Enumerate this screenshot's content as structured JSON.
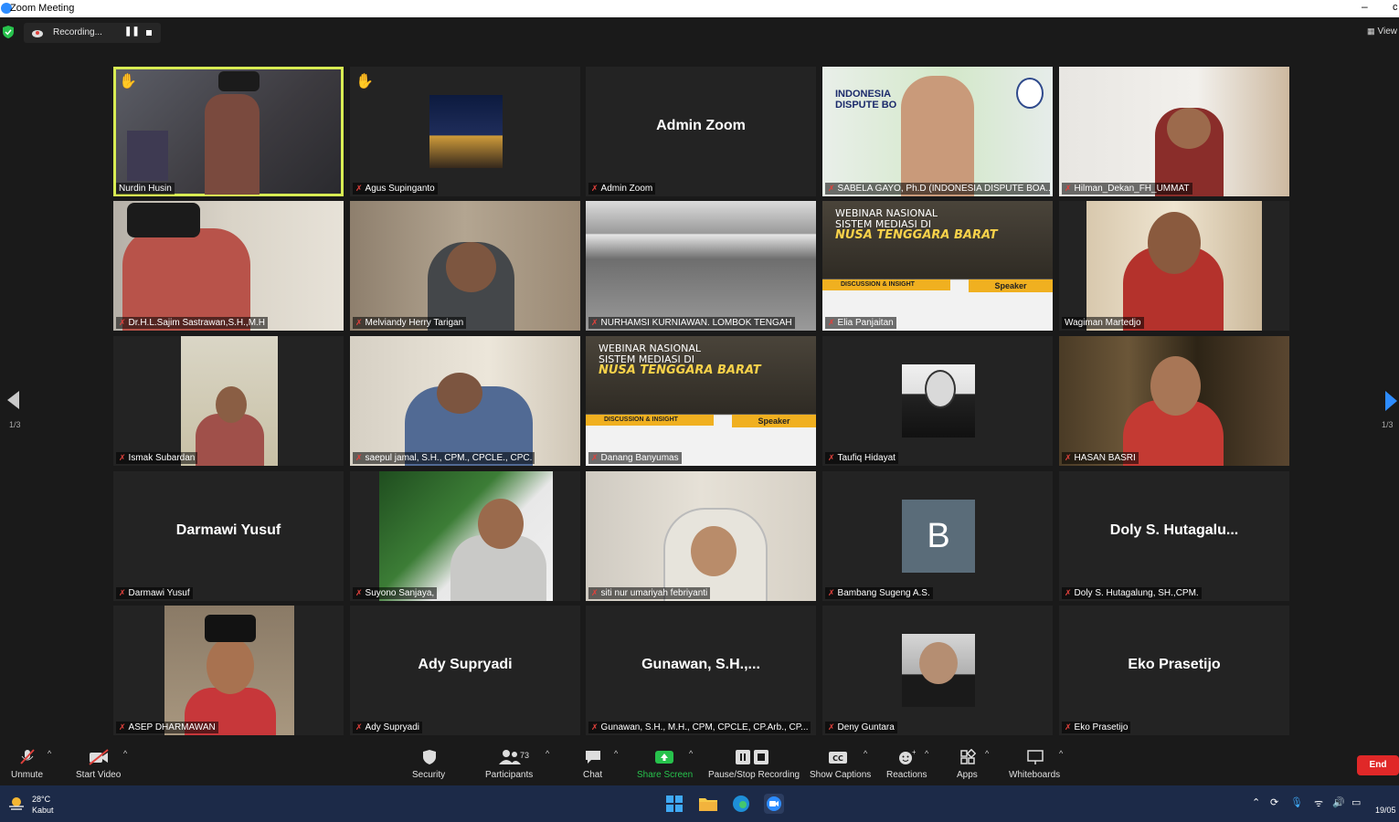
{
  "window": {
    "title": "Zoom Meeting",
    "minimize": "–",
    "close_clip": "c"
  },
  "status": {
    "recording_text": "Recording...",
    "pause_icon": "pause-icon",
    "stop_icon": "stop-icon",
    "view_label": "View"
  },
  "pager": {
    "page_left": "1/3",
    "page_right": "1/3"
  },
  "participants": [
    {
      "name": "Nurdin Husin",
      "speaking": true,
      "hand": true,
      "muted": false,
      "video": true
    },
    {
      "name": "Agus Supinganto",
      "hand": true,
      "muted": true,
      "video": true
    },
    {
      "name": "Admin Zoom",
      "center": "Admin Zoom",
      "muted": true,
      "video": false
    },
    {
      "name": "SABELA GAYO, Ph.D (INDONESIA DISPUTE BOA...",
      "muted": true,
      "video": true,
      "overlay": [
        "INDONESIA",
        "DISPUTE BO"
      ]
    },
    {
      "name": "Hilman_Dekan_FH_UMMAT",
      "muted": true,
      "video": true
    },
    {
      "name": "Dr.H.L.Sajim Sastrawan,S.H.,M.H",
      "muted": true,
      "video": true
    },
    {
      "name": "Melviandy Herry Tarigan",
      "muted": true,
      "video": true
    },
    {
      "name": "NURHAMSI KURNIAWAN. LOMBOK TENGAH",
      "muted": true,
      "video": true
    },
    {
      "name": "Elia Panjaitan",
      "muted": true,
      "video": true,
      "poster": [
        "WEBINAR NASIONAL",
        "SISTEM MEDIASI DI",
        "NUSA TENGGARA BARAT",
        "DISCUSSION & INSIGHT",
        "Speaker"
      ]
    },
    {
      "name": "Wagiman Martedjo",
      "muted": false,
      "video": true
    },
    {
      "name": "Ismak Subardan",
      "muted": true,
      "video": true
    },
    {
      "name": "saepul jamal, S.H., CPM., CPCLE., CPC.",
      "muted": true,
      "video": true
    },
    {
      "name": "Danang Banyumas",
      "muted": true,
      "video": true,
      "poster": [
        "WEBINAR NASIONAL",
        "SISTEM MEDIASI DI",
        "NUSA TENGGARA BARAT",
        "DISCUSSION & INSIGHT",
        "Speaker"
      ]
    },
    {
      "name": "Taufiq Hidayat",
      "muted": true,
      "video": true
    },
    {
      "name": "HASAN BASRI",
      "muted": true,
      "video": true
    },
    {
      "name": "Darmawi Yusuf",
      "center": "Darmawi Yusuf",
      "muted": true,
      "video": false
    },
    {
      "name": "Suyono Sanjaya,",
      "muted": true,
      "video": true
    },
    {
      "name": "siti nur umariyah febriyanti",
      "muted": true,
      "video": true
    },
    {
      "name": "Bambang Sugeng A.S.",
      "avatar": "B",
      "muted": true,
      "video": false
    },
    {
      "name": "Doly S. Hutagalung, SH.,CPM.",
      "center": "Doly S. Hutagalu...",
      "muted": true,
      "video": false
    },
    {
      "name": "ASEP DHARMAWAN",
      "muted": true,
      "video": true
    },
    {
      "name": "Ady Supryadi",
      "center": "Ady Supryadi",
      "muted": true,
      "video": false
    },
    {
      "name": "Gunawan, S.H., M.H., CPM, CPCLE, CP.Arb., CP...",
      "center": "Gunawan, S.H.,...",
      "muted": true,
      "video": false
    },
    {
      "name": "Deny Guntara",
      "muted": true,
      "video": true
    },
    {
      "name": "Eko Prasetijo",
      "center": "Eko Prasetijo",
      "muted": true,
      "video": false
    }
  ],
  "toolbar": {
    "unmute": "Unmute",
    "start_video": "Start Video",
    "security": "Security",
    "participants": "Participants",
    "participants_count": "73",
    "chat": "Chat",
    "share_screen": "Share Screen",
    "recording": "Pause/Stop Recording",
    "captions": "Show Captions",
    "reactions": "Reactions",
    "apps": "Apps",
    "whiteboards": "Whiteboards",
    "end": "End",
    "captions_icon_text": "CC"
  },
  "taskbar": {
    "temperature": "28°C",
    "weather": "Kabut",
    "date": "19/05"
  },
  "colors": {
    "speaking_border": "#d8ec53",
    "share_green": "#27c24c",
    "end_red": "#e02828",
    "zoom_blue": "#2d8cff",
    "mute_red": "#e0413c"
  }
}
